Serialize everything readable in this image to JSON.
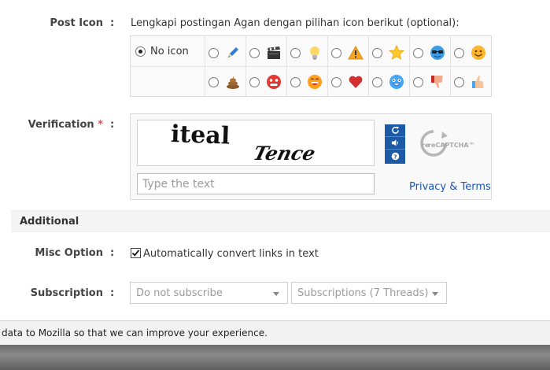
{
  "post_icon": {
    "label": "Post Icon",
    "colon": ":",
    "intro": "Lengkapi postingan Agan dengan pilihan icon berikut (optional):",
    "no_icon_label": "No icon",
    "icons_row1": [
      "pencil-icon",
      "clapperboard-icon",
      "lightbulb-icon",
      "warning-icon",
      "star-icon",
      "cool-sunglasses-icon",
      "smile-icon"
    ],
    "icons_row2": [
      "poop-icon",
      "angry-red-face-icon",
      "laughing-face-icon",
      "heart-icon",
      "surprised-blue-face-icon",
      "thumbs-down-icon",
      "thumbs-up-icon"
    ]
  },
  "verification": {
    "label": "Verification",
    "required_mark": "*",
    "colon": ":",
    "captcha_word1": "iteal",
    "captcha_word2": "Tence",
    "input_placeholder": "Type the text",
    "privacy_link": "Privacy & Terms",
    "logo_text": "reCAPTCHA™"
  },
  "additional": {
    "title": "Additional"
  },
  "misc_option": {
    "label": "Misc Option",
    "colon": ":",
    "checkbox_label": "Automatically convert links in text",
    "checked": true
  },
  "subscription": {
    "label": "Subscription",
    "colon": ":",
    "select1_value": "Do not subscribe",
    "select2_value": "Subscriptions (7 Threads)"
  },
  "notice": {
    "text": "data to Mozilla so that we can improve your experience."
  },
  "colors": {
    "link": "#1a55b8",
    "recaptcha_blue": "#1c5aa8",
    "required": "#e05050"
  }
}
